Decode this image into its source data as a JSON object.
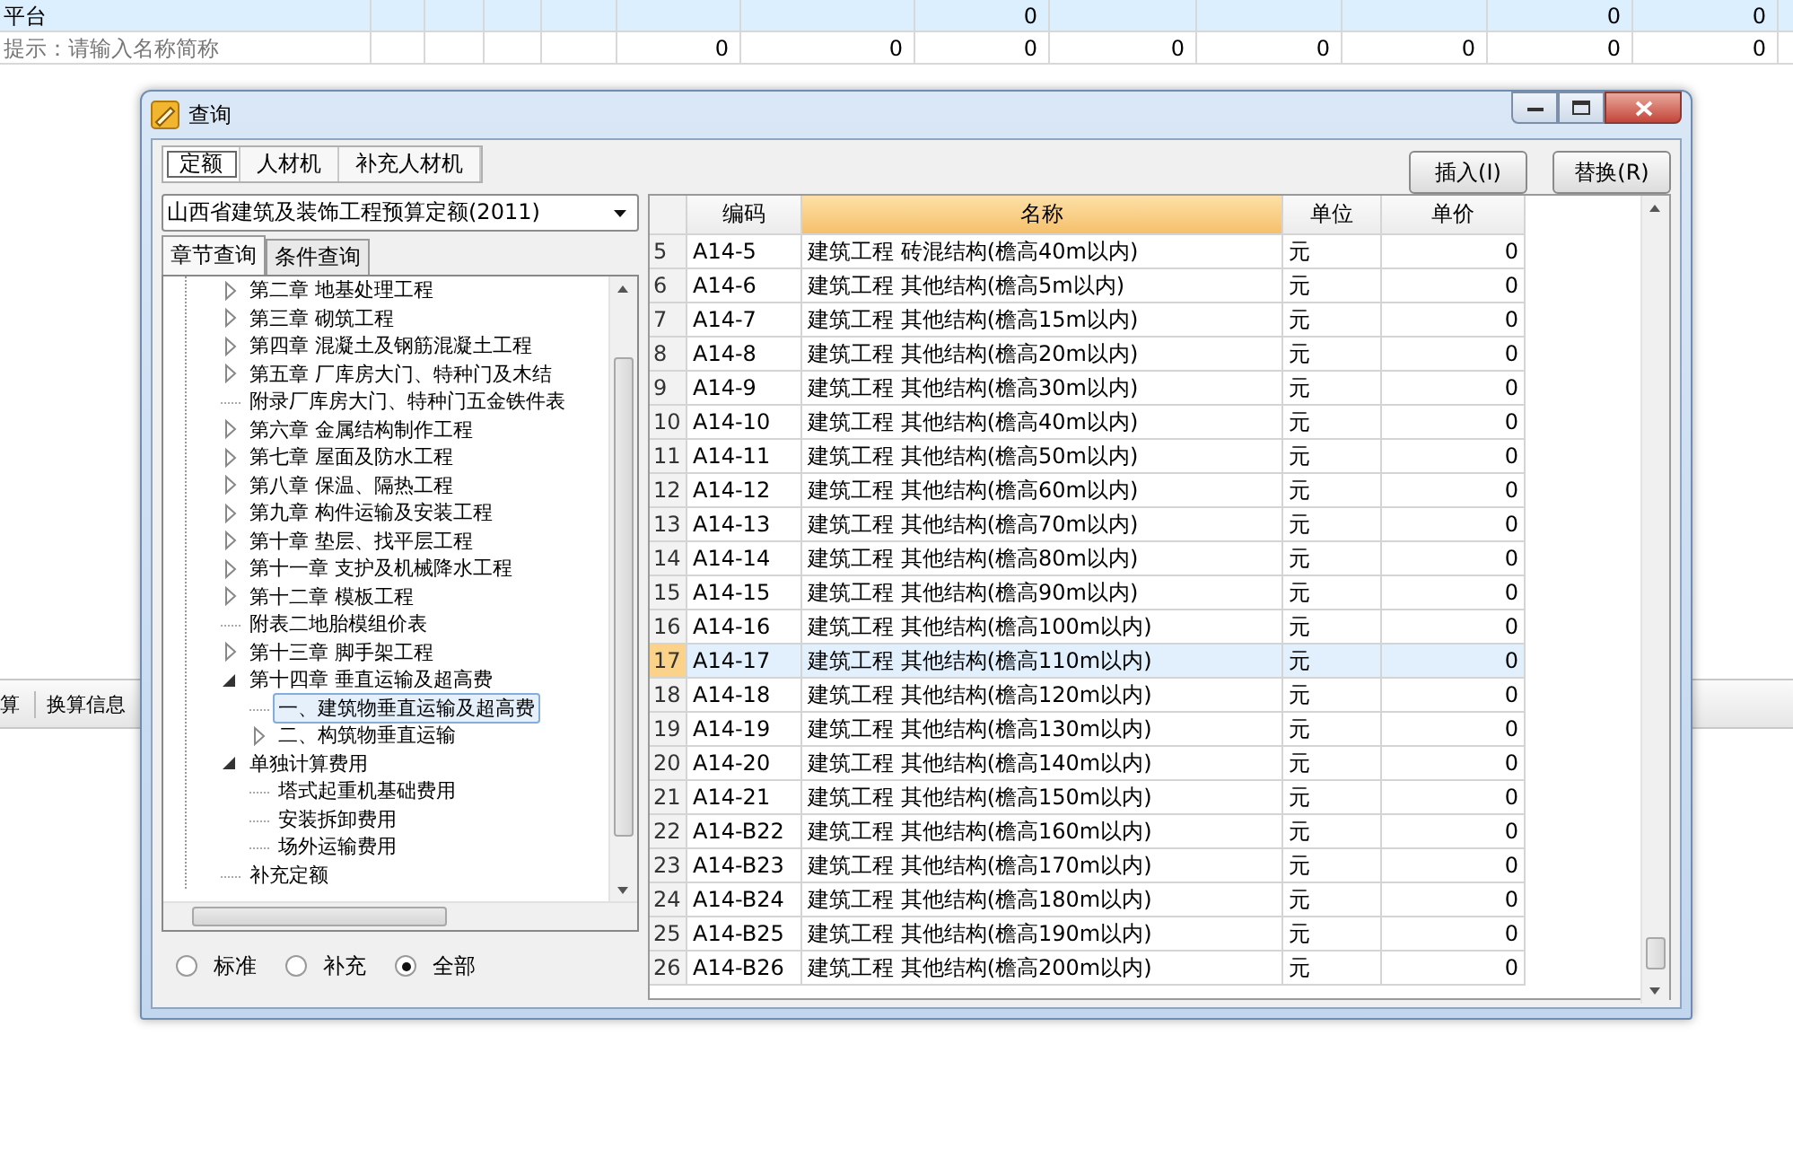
{
  "background": {
    "table_rows": [
      {
        "label": "平台",
        "selected": true,
        "cells": {
          "column_7": "0",
          "column_11": "0",
          "column_12": "0"
        }
      },
      {
        "label": "提示：请输入名称简称",
        "selected": false,
        "cells": {
          "column_5": "0",
          "column_6": "0",
          "column_7": "0",
          "column_8": "0",
          "column_9": "0",
          "column_10": "0",
          "column_11": "0",
          "column_12": "0"
        }
      }
    ],
    "tabs": [
      "算",
      "换算信息"
    ]
  },
  "dialog": {
    "title": "查询",
    "tabs": [
      {
        "label": "定额",
        "selected": true
      },
      {
        "label": "人材机",
        "selected": false
      },
      {
        "label": "补充人材机",
        "selected": false
      }
    ],
    "buttons": [
      "插入(I)",
      "替换(R)"
    ],
    "library": "山西省建筑及装饰工程预算定额(2011)",
    "sub_tabs": [
      {
        "label": "章节查询",
        "selected": true
      },
      {
        "label": "条件查询",
        "selected": false
      }
    ],
    "tree": [
      {
        "label": "第二章 地基处理工程",
        "expanded": false,
        "selected": false
      },
      {
        "label": "第三章 砌筑工程",
        "expanded": false,
        "selected": false
      },
      {
        "label": "第四章 混凝土及钢筋混凝土工程",
        "expanded": false,
        "selected": false
      },
      {
        "label": "第五章 厂库房大门、特种门及木结",
        "expanded": false,
        "selected": false
      },
      {
        "label": "附录厂库房大门、特种门五金铁件表",
        "selected": false
      },
      {
        "label": "第六章 金属结构制作工程",
        "expanded": false,
        "selected": false
      },
      {
        "label": "第七章 屋面及防水工程",
        "expanded": false,
        "selected": false
      },
      {
        "label": "第八章 保温、隔热工程",
        "expanded": false,
        "selected": false
      },
      {
        "label": "第九章 构件运输及安装工程",
        "expanded": false,
        "selected": false
      },
      {
        "label": "第十章 垫层、找平层工程",
        "expanded": false,
        "selected": false
      },
      {
        "label": "第十一章 支护及机械降水工程",
        "expanded": false,
        "selected": false
      },
      {
        "label": "第十二章 模板工程",
        "expanded": false,
        "selected": false
      },
      {
        "label": "附表二地胎模组价表",
        "selected": false
      },
      {
        "label": "第十三章 脚手架工程",
        "expanded": false,
        "selected": false
      },
      {
        "label": "第十四章 垂直运输及超高费",
        "expanded": true,
        "selected": false,
        "children": [
          {
            "label": "一、建筑物垂直运输及超高费",
            "selected": true
          },
          {
            "label": "二、构筑物垂直运输",
            "expanded": false,
            "selected": false
          }
        ]
      },
      {
        "label": "单独计算费用",
        "expanded": true,
        "selected": false,
        "children": [
          {
            "label": "塔式起重机基础费用",
            "selected": false
          },
          {
            "label": "安装拆卸费用",
            "selected": false
          },
          {
            "label": "场外运输费用",
            "selected": false
          }
        ]
      },
      {
        "label": "补充定额",
        "selected": false
      }
    ],
    "filter_options": [
      {
        "label": "标准",
        "selected": false
      },
      {
        "label": "补充",
        "selected": false
      },
      {
        "label": "全部",
        "selected": true
      }
    ],
    "table": {
      "columns": [
        {
          "label": "编码",
          "selected": false
        },
        {
          "label": "名称",
          "selected": true
        },
        {
          "label": "单位",
          "selected": false
        },
        {
          "label": "单价",
          "selected": false
        }
      ],
      "rows": [
        {
          "number": "5",
          "code": "A14-5",
          "name": "建筑工程 砖混结构(檐高40m以内)",
          "unit": "元",
          "price": "0",
          "selected": false
        },
        {
          "number": "6",
          "code": "A14-6",
          "name": "建筑工程 其他结构(檐高5m以内)",
          "unit": "元",
          "price": "0",
          "selected": false
        },
        {
          "number": "7",
          "code": "A14-7",
          "name": "建筑工程 其他结构(檐高15m以内)",
          "unit": "元",
          "price": "0",
          "selected": false
        },
        {
          "number": "8",
          "code": "A14-8",
          "name": "建筑工程 其他结构(檐高20m以内)",
          "unit": "元",
          "price": "0",
          "selected": false
        },
        {
          "number": "9",
          "code": "A14-9",
          "name": "建筑工程 其他结构(檐高30m以内)",
          "unit": "元",
          "price": "0",
          "selected": false
        },
        {
          "number": "10",
          "code": "A14-10",
          "name": "建筑工程 其他结构(檐高40m以内)",
          "unit": "元",
          "price": "0",
          "selected": false
        },
        {
          "number": "11",
          "code": "A14-11",
          "name": "建筑工程 其他结构(檐高50m以内)",
          "unit": "元",
          "price": "0",
          "selected": false
        },
        {
          "number": "12",
          "code": "A14-12",
          "name": "建筑工程 其他结构(檐高60m以内)",
          "unit": "元",
          "price": "0",
          "selected": false
        },
        {
          "number": "13",
          "code": "A14-13",
          "name": "建筑工程 其他结构(檐高70m以内)",
          "unit": "元",
          "price": "0",
          "selected": false
        },
        {
          "number": "14",
          "code": "A14-14",
          "name": "建筑工程 其他结构(檐高80m以内)",
          "unit": "元",
          "price": "0",
          "selected": false
        },
        {
          "number": "15",
          "code": "A14-15",
          "name": "建筑工程 其他结构(檐高90m以内)",
          "unit": "元",
          "price": "0",
          "selected": false
        },
        {
          "number": "16",
          "code": "A14-16",
          "name": "建筑工程 其他结构(檐高100m以内)",
          "unit": "元",
          "price": "0",
          "selected": false
        },
        {
          "number": "17",
          "code": "A14-17",
          "name": "建筑工程 其他结构(檐高110m以内)",
          "unit": "元",
          "price": "0",
          "selected": true
        },
        {
          "number": "18",
          "code": "A14-18",
          "name": "建筑工程 其他结构(檐高120m以内)",
          "unit": "元",
          "price": "0",
          "selected": false
        },
        {
          "number": "19",
          "code": "A14-19",
          "name": "建筑工程 其他结构(檐高130m以内)",
          "unit": "元",
          "price": "0",
          "selected": false
        },
        {
          "number": "20",
          "code": "A14-20",
          "name": "建筑工程 其他结构(檐高140m以内)",
          "unit": "元",
          "price": "0",
          "selected": false
        },
        {
          "number": "21",
          "code": "A14-21",
          "name": "建筑工程 其他结构(檐高150m以内)",
          "unit": "元",
          "price": "0",
          "selected": false
        },
        {
          "number": "22",
          "code": "A14-B22",
          "name": "建筑工程 其他结构(檐高160m以内)",
          "unit": "元",
          "price": "0",
          "selected": false
        },
        {
          "number": "23",
          "code": "A14-B23",
          "name": "建筑工程 其他结构(檐高170m以内)",
          "unit": "元",
          "price": "0",
          "selected": false
        },
        {
          "number": "24",
          "code": "A14-B24",
          "name": "建筑工程 其他结构(檐高180m以内)",
          "unit": "元",
          "price": "0",
          "selected": false
        },
        {
          "number": "25",
          "code": "A14-B25",
          "name": "建筑工程 其他结构(檐高190m以内)",
          "unit": "元",
          "price": "0",
          "selected": false
        },
        {
          "number": "26",
          "code": "A14-B26",
          "name": "建筑工程 其他结构(檐高200m以内)",
          "unit": "元",
          "price": "0",
          "selected": false
        }
      ]
    }
  }
}
